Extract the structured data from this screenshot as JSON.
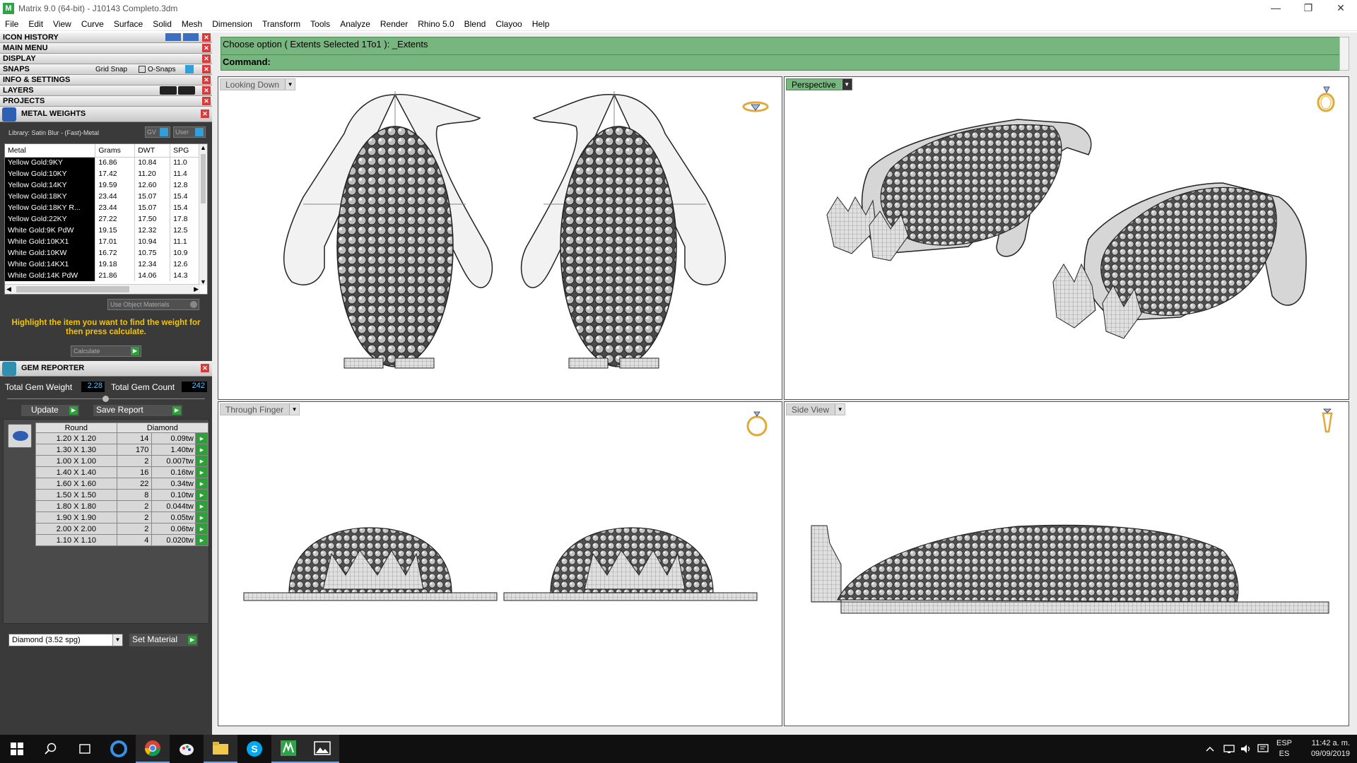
{
  "window": {
    "title": "Matrix 9.0 (64-bit) - J10143 Completo.3dm",
    "app_icon": "M",
    "minimize": "—",
    "maximize": "❐",
    "close": "✕"
  },
  "menu": [
    "File",
    "Edit",
    "View",
    "Curve",
    "Surface",
    "Solid",
    "Mesh",
    "Dimension",
    "Transform",
    "Tools",
    "Analyze",
    "Render",
    "Rhino 5.0",
    "Blend",
    "Clayoo",
    "Help"
  ],
  "left_sections": {
    "icon_history": "ICON HISTORY",
    "main_menu": "MAIN MENU",
    "display": "DISPLAY",
    "snaps": "SNAPS",
    "grid_snap": "Grid Snap",
    "o_snaps": "O-Snaps",
    "info_settings": "INFO & SETTINGS",
    "layers": "LAYERS",
    "projects": "PROJECTS",
    "close_glyph": "✕"
  },
  "metal_weights": {
    "title": "METAL WEIGHTS",
    "library": "Library: Satin Blur - (Fast)-Metal",
    "gv_label": "GV",
    "user_label": "User",
    "columns": [
      "Metal",
      "Grams",
      "DWT",
      "SPG"
    ],
    "rows": [
      [
        "Yellow Gold:9KY",
        "16.86",
        "10.84",
        "11.0"
      ],
      [
        "Yellow Gold:10KY",
        "17.42",
        "11.20",
        "11.4"
      ],
      [
        "Yellow Gold:14KY",
        "19.59",
        "12.60",
        "12.8"
      ],
      [
        "Yellow Gold:18KY",
        "23.44",
        "15.07",
        "15.4"
      ],
      [
        "Yellow Gold:18KY R...",
        "23.44",
        "15.07",
        "15.4"
      ],
      [
        "Yellow Gold:22KY",
        "27.22",
        "17.50",
        "17.8"
      ],
      [
        "White Gold:9K PdW",
        "19.15",
        "12.32",
        "12.5"
      ],
      [
        "White Gold:10KX1",
        "17.01",
        "10.94",
        "11.1"
      ],
      [
        "White Gold:10KW",
        "16.72",
        "10.75",
        "10.9"
      ],
      [
        "White Gold:14KX1",
        "19.18",
        "12.34",
        "12.6"
      ],
      [
        "White Gold:14K PdW",
        "21.86",
        "14.06",
        "14.3"
      ]
    ],
    "use_object_materials": "Use Object Materials",
    "hint": "Highlight the item you want to find the weight for then press calculate.",
    "calculate": "Calculate",
    "scroll_up": "▲",
    "scroll_down": "▼",
    "scroll_left": "◀",
    "scroll_right": "▶"
  },
  "gem_reporter": {
    "title": "GEM REPORTER",
    "total_weight_label": "Total Gem Weight",
    "total_weight": "2.28",
    "total_count_label": "Total Gem Count",
    "total_count": "242",
    "update": "Update",
    "save_report": "Save Report",
    "col_shape": "Round",
    "col_type": "Diamond",
    "rows": [
      {
        "size": "1.20 X 1.20",
        "qty": "14",
        "tw": "0.09tw"
      },
      {
        "size": "1.30 X 1.30",
        "qty": "170",
        "tw": "1.40tw"
      },
      {
        "size": "1.00 X 1.00",
        "qty": "2",
        "tw": "0.007tw"
      },
      {
        "size": "1.40 X 1.40",
        "qty": "16",
        "tw": "0.16tw"
      },
      {
        "size": "1.60 X 1.60",
        "qty": "22",
        "tw": "0.34tw"
      },
      {
        "size": "1.50 X 1.50",
        "qty": "8",
        "tw": "0.10tw"
      },
      {
        "size": "1.80 X 1.80",
        "qty": "2",
        "tw": "0.044tw"
      },
      {
        "size": "1.90 X 1.90",
        "qty": "2",
        "tw": "0.05tw"
      },
      {
        "size": "2.00 X 2.00",
        "qty": "2",
        "tw": "0.06tw"
      },
      {
        "size": "1.10 X 1.10",
        "qty": "4",
        "tw": "0.020tw"
      }
    ],
    "material": "Diamond   (3.52 spg)",
    "set_material": "Set Material",
    "play": "▶",
    "dropdown": "▼"
  },
  "command": {
    "line1": "Choose option ( Extents  Selected  1To1 ): _Extents",
    "line2": "Command:"
  },
  "viewports": {
    "top_left": "Looking Down",
    "top_right": "Perspective",
    "bottom_left": "Through Finger",
    "bottom_right": "Side View",
    "dropdown": "▼"
  },
  "taskbar": {
    "lang": "ESP",
    "region": "ES",
    "time": "11:42 a. m.",
    "date": "09/09/2019"
  },
  "colors": {
    "command_bg": "#78b67f",
    "panel_bg": "#3a3a3a",
    "hint_text": "#f5c400",
    "value_text": "#5bc4ff"
  }
}
